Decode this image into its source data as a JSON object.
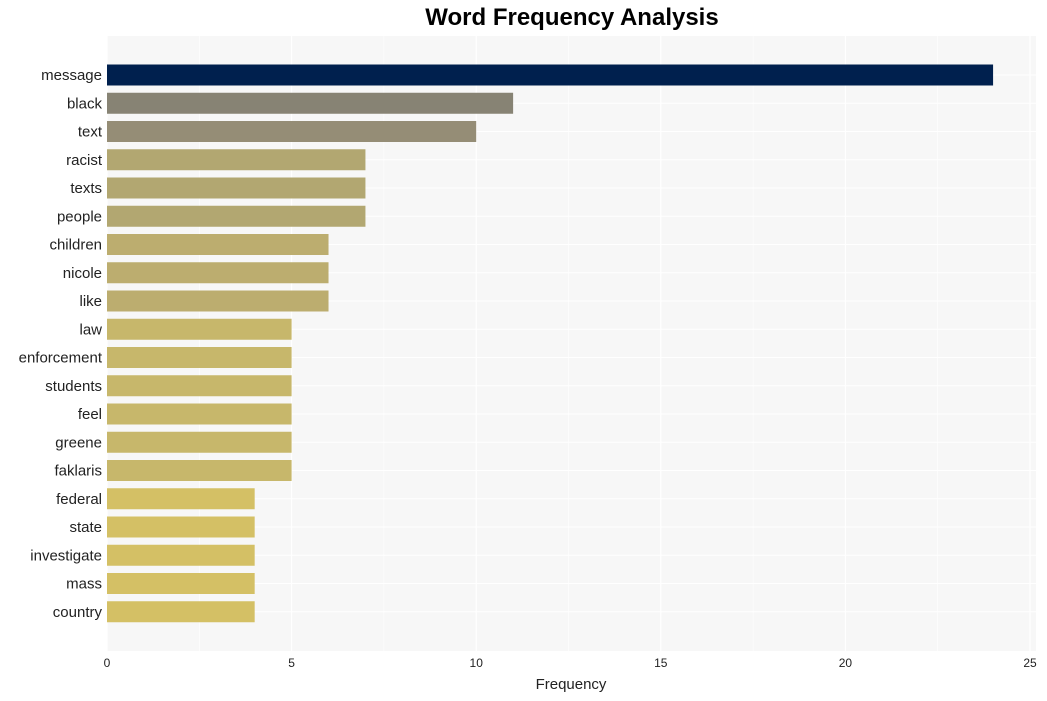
{
  "chart_data": {
    "type": "bar",
    "orientation": "horizontal",
    "title": "Word Frequency Analysis",
    "xlabel": "Frequency",
    "ylabel": "",
    "xlim": [
      0,
      25
    ],
    "xticks": [
      0,
      5,
      10,
      15,
      20,
      25
    ],
    "grid": true,
    "categories": [
      "message",
      "black",
      "text",
      "racist",
      "texts",
      "people",
      "children",
      "nicole",
      "like",
      "law",
      "enforcement",
      "students",
      "feel",
      "greene",
      "faklaris",
      "federal",
      "state",
      "investigate",
      "mass",
      "country"
    ],
    "values": [
      24,
      11,
      10,
      7,
      7,
      7,
      6,
      6,
      6,
      5,
      5,
      5,
      5,
      5,
      5,
      4,
      4,
      4,
      4,
      4
    ],
    "colors": [
      "#00204e",
      "#878374",
      "#958d76",
      "#b2a771",
      "#b2a771",
      "#b2a771",
      "#bcad6f",
      "#bcad6f",
      "#bcad6f",
      "#c7b76b",
      "#c7b76b",
      "#c7b76b",
      "#c7b76b",
      "#c7b76b",
      "#c7b76b",
      "#d4c065",
      "#d4c065",
      "#d4c065",
      "#d4c065",
      "#d4c065"
    ]
  }
}
